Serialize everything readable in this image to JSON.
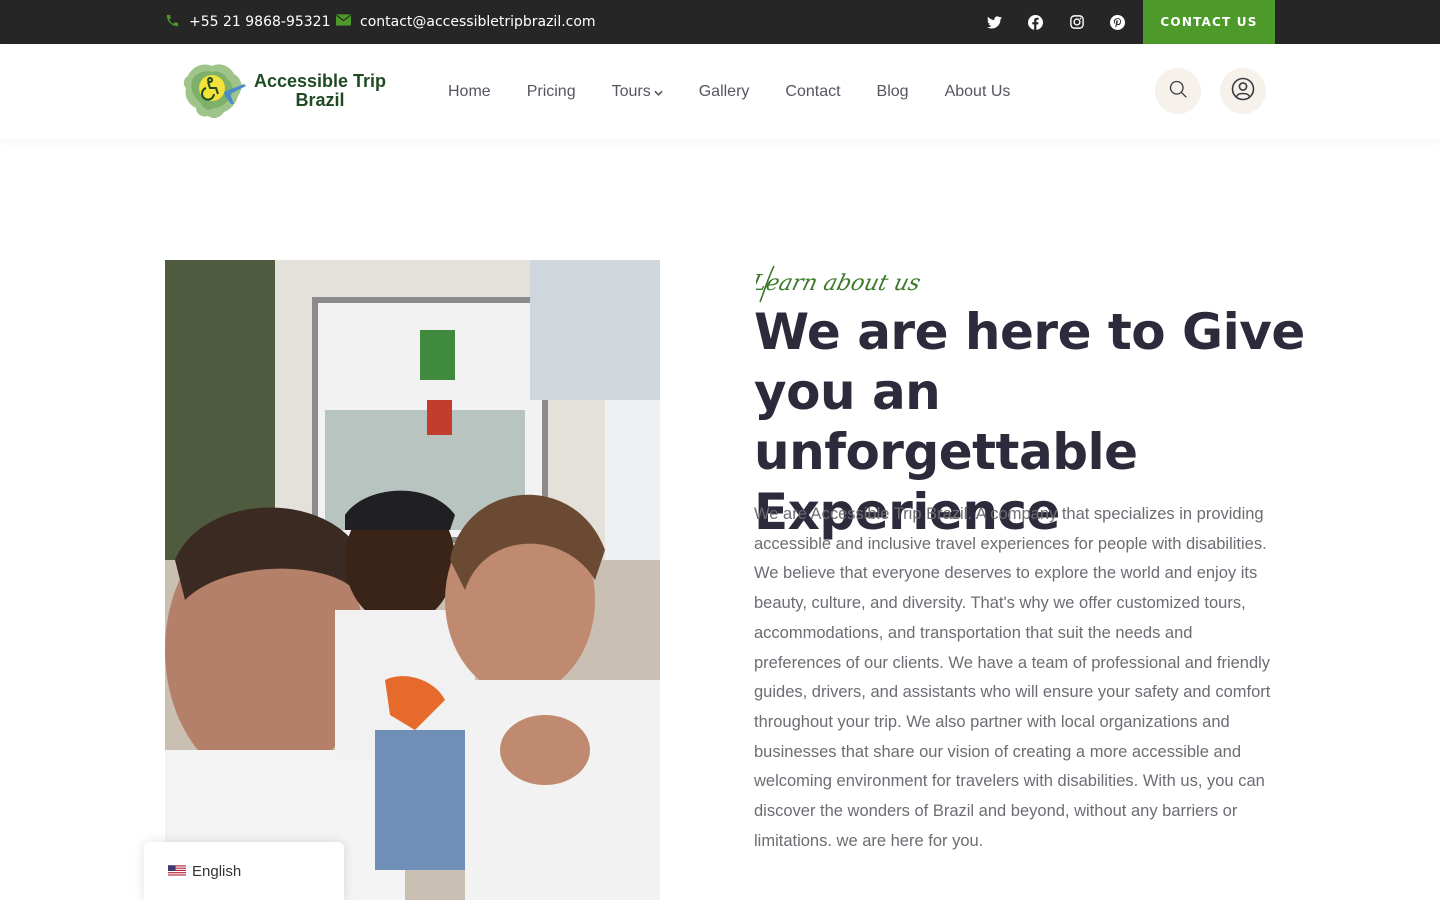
{
  "topbar": {
    "phone": "+55 21 9868-95321",
    "email": "contact@accessibletripbrazil.com",
    "social": [
      "twitter-icon",
      "facebook-icon",
      "instagram-icon",
      "pinterest-icon"
    ],
    "contact_button": "CONTACT US"
  },
  "header": {
    "logo_line1": "Accessible Trip",
    "logo_line2": "Brazil",
    "nav": {
      "home": "Home",
      "pricing": "Pricing",
      "tours": "Tours",
      "gallery": "Gallery",
      "contact": "Contact",
      "blog": "Blog",
      "about": "About Us"
    }
  },
  "about": {
    "tagline": "Learn about us",
    "headline": "We are here to Give you an unforgettable Experience",
    "body": "We are Accessible Trip Brazil. A company that specializes in providing accessible and inclusive travel experiences for people with disabilities. We believe that everyone deserves to explore the world and enjoy its beauty, culture, and diversity. That's why we offer customized tours, accommodations, and transportation that suit the needs and preferences of our clients. We have a team of professional and friendly guides, drivers, and assistants who will ensure your safety and comfort throughout your trip. We also partner with local organizations and businesses that share our vision of creating a more accessible and welcoming environment for travelers with disabilities. With us, you can discover the wonders of Brazil and beyond, without any barriers or limitations. we are here for you."
  },
  "language": {
    "label": "English",
    "flag": "us-flag-icon"
  },
  "colors": {
    "topbar_bg": "#262626",
    "accent_green": "#4d9a2a",
    "headline": "#2c2b3b",
    "body_text": "#6c6d73",
    "nav_text": "#55565f"
  }
}
